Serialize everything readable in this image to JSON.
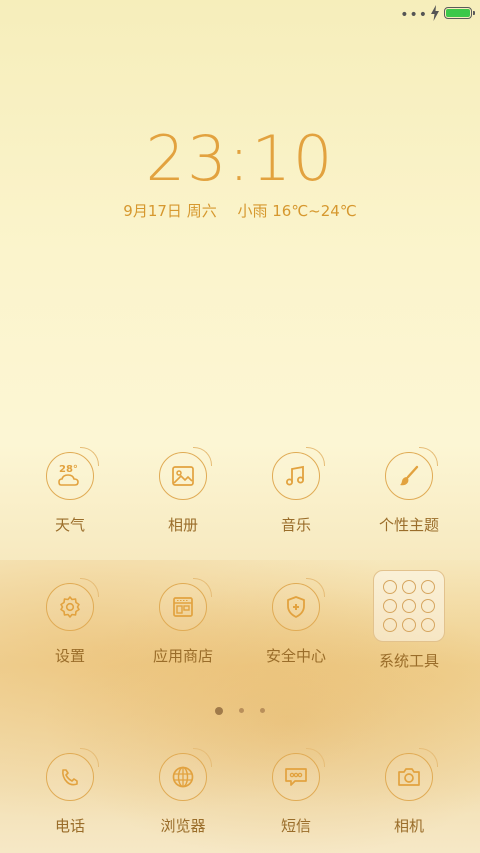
{
  "status_bar": {
    "more": "•••"
  },
  "lockscreen": {
    "time": "23:10",
    "date": "9月17日 周六",
    "weather": "小雨 16℃~24℃"
  },
  "apps": [
    {
      "label": "天气",
      "icon": "weather-icon",
      "temp": "28°"
    },
    {
      "label": "相册",
      "icon": "gallery-icon"
    },
    {
      "label": "音乐",
      "icon": "music-icon"
    },
    {
      "label": "个性主题",
      "icon": "theme-brush-icon"
    },
    {
      "label": "设置",
      "icon": "settings-gear-icon"
    },
    {
      "label": "应用商店",
      "icon": "app-store-icon"
    },
    {
      "label": "安全中心",
      "icon": "security-shield-icon"
    },
    {
      "label": "系统工具",
      "icon": "tools-folder-icon"
    }
  ],
  "dock": [
    {
      "label": "电话",
      "icon": "phone-icon"
    },
    {
      "label": "浏览器",
      "icon": "browser-globe-icon"
    },
    {
      "label": "短信",
      "icon": "message-icon"
    },
    {
      "label": "相机",
      "icon": "camera-icon"
    }
  ],
  "pager": {
    "pages": 3,
    "current": 1
  },
  "colors": {
    "accent": "#e2a23f",
    "label": "#9a6d2a",
    "battery": "#3cc84a"
  }
}
